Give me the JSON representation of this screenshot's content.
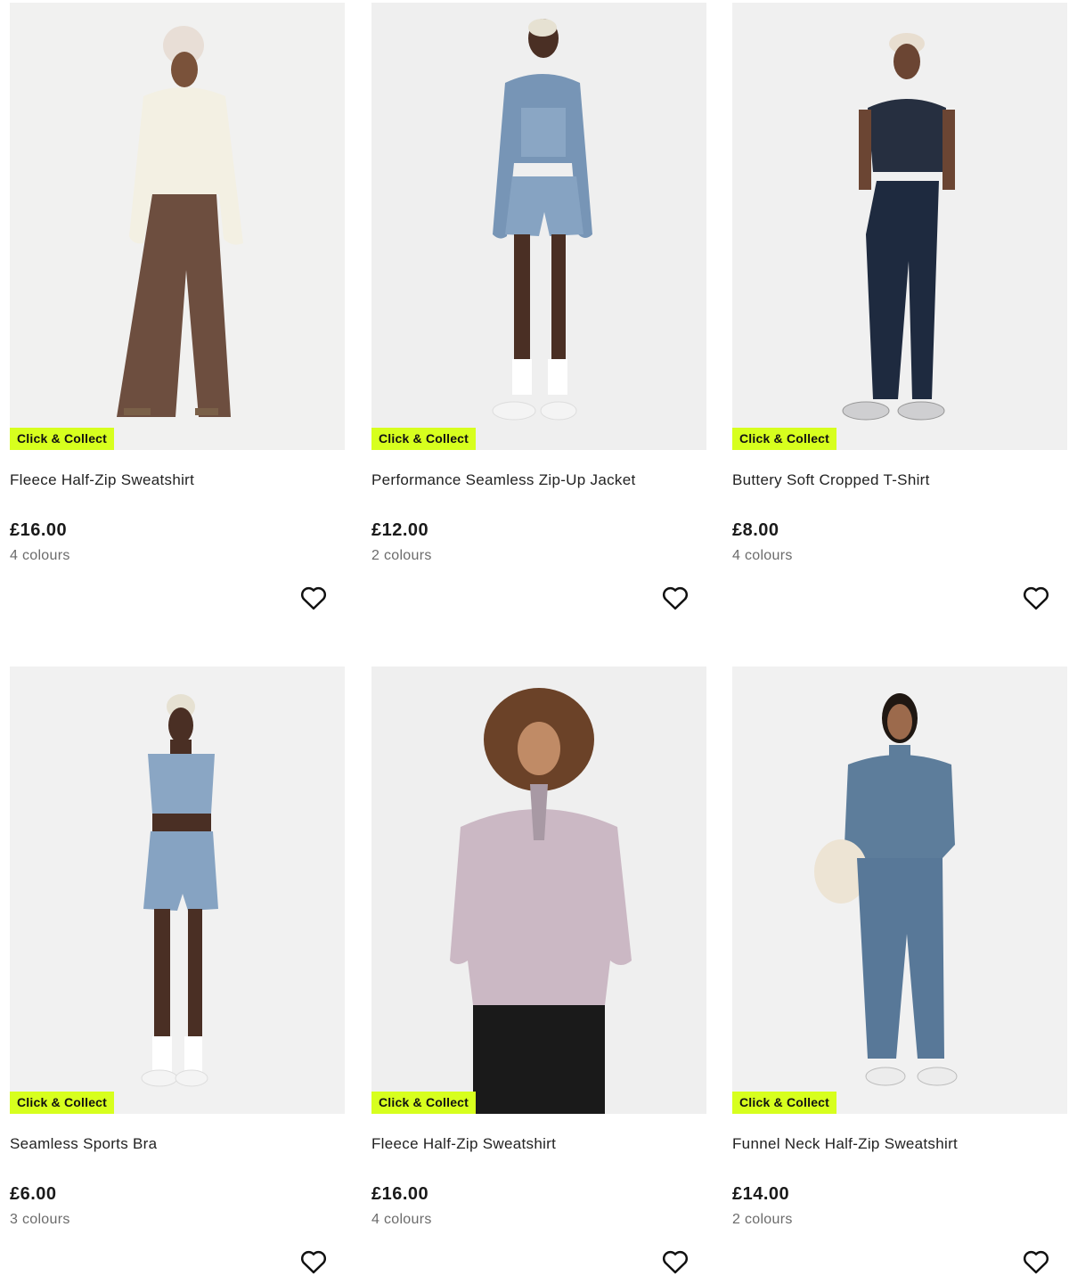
{
  "colors": {
    "badge_bg": "#d7ff1e",
    "image_bg": "#f2f2f2",
    "text": "#1a1a1a",
    "muted": "#6b6b6b"
  },
  "products": [
    {
      "badge": "Click & Collect",
      "name": "Fleece Half-Zip Sweatshirt",
      "price": "£16.00",
      "colours": "4 colours",
      "wishlist_icon": "heart-outline-icon"
    },
    {
      "badge": "Click & Collect",
      "name": "Performance Seamless Zip-Up Jacket",
      "price": "£12.00",
      "colours": "2 colours",
      "wishlist_icon": "heart-outline-icon"
    },
    {
      "badge": "Click & Collect",
      "name": "Buttery Soft Cropped T-Shirt",
      "price": "£8.00",
      "colours": "4 colours",
      "wishlist_icon": "heart-outline-icon"
    },
    {
      "badge": "Click & Collect",
      "name": "Seamless Sports Bra",
      "price": "£6.00",
      "colours": "3 colours",
      "wishlist_icon": "heart-outline-icon"
    },
    {
      "badge": "Click & Collect",
      "name": "Fleece Half-Zip Sweatshirt",
      "price": "£16.00",
      "colours": "4 colours",
      "wishlist_icon": "heart-outline-icon"
    },
    {
      "badge": "Click & Collect",
      "name": "Funnel Neck Half-Zip Sweatshirt",
      "price": "£14.00",
      "colours": "2 colours",
      "wishlist_icon": "heart-outline-icon"
    }
  ]
}
